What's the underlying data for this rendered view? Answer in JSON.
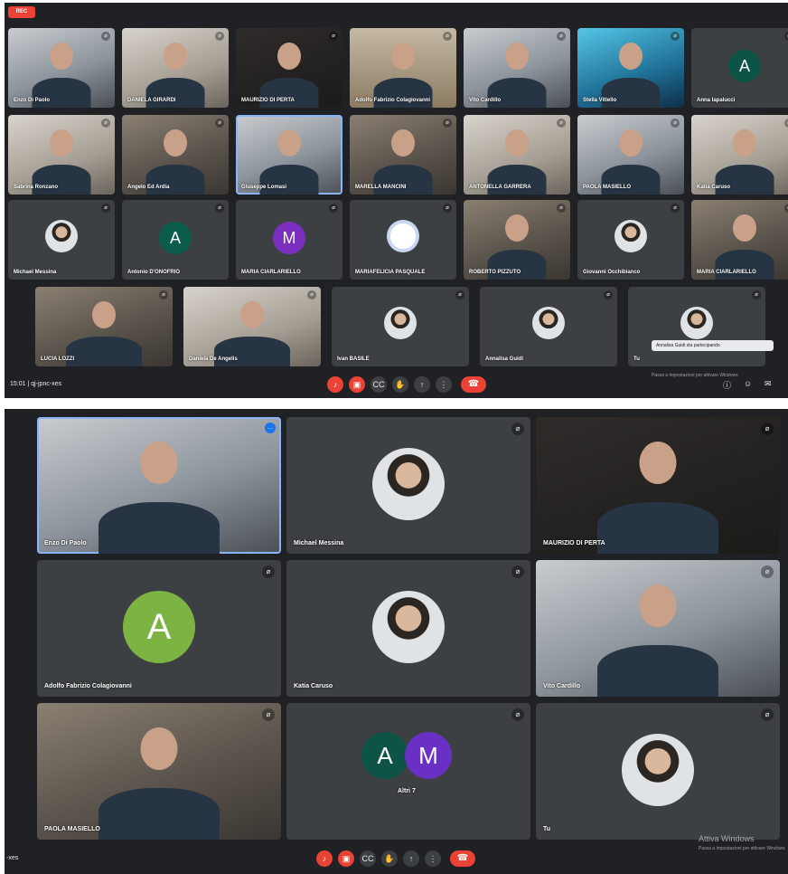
{
  "top": {
    "rec_label": "REC",
    "meeting_time": "15:01",
    "meeting_code": "qj-jpnc-xes",
    "notification_text": "Annalisa Guidi sta partecipando",
    "windows_hint": "Passa a Impostazioni per attivare Windows",
    "rows": [
      [
        "Enzo Di Paolo",
        "DANIELA GIRARDI",
        "MAURIZIO DI PERTA",
        "Adolfo Fabrizio Colagiovanni",
        "Vito Cardillo",
        "Stella Vitiello",
        "Anna Iapaluccì"
      ],
      [
        "Sabrina Ronzano",
        "Angelo Ed Ardia",
        "Giuseppe Lomasi",
        "MARELLA MANCINI",
        "ANTONELLA GARRERA",
        "PAOLA MASIELLO",
        "Katia Caruso"
      ],
      [
        "Michael Messina",
        "Antonio D'ONOFRIO",
        "MARIA CIARLARIELLO",
        "MARIAFELICIA PASQUALE",
        "ROBERTO PIZZUTO",
        "Giovanni Occhibianco",
        "MARIA CIARLARIELLO"
      ],
      [
        "LUCIA LOZZI",
        "Daniela De Angelis",
        "Ivan BASILE",
        "Annalisa Guidi",
        "Tu"
      ]
    ],
    "avatar_letters": {
      "anna": "A",
      "antonio": "A",
      "maria": "M"
    }
  },
  "bottom": {
    "meeting_code_suffix": "-xes",
    "tiles": [
      {
        "name": "Enzo Di Paolo"
      },
      {
        "name": "Michael Messina"
      },
      {
        "name": "MAURIZIO DI PERTA"
      },
      {
        "name": "Adolfo Fabrizio Colagiovanni",
        "letter": "A"
      },
      {
        "name": "Katia Caruso"
      },
      {
        "name": "Vito Cardillo"
      },
      {
        "name": "PAOLA MASIELLO"
      },
      {
        "name": "Altri 7",
        "letters": [
          "A",
          "M"
        ]
      },
      {
        "name": "Tu"
      }
    ],
    "watermark_title": "Attiva Windows",
    "watermark_sub": "Passa a Impostazioni per attivare Windows"
  },
  "toolbar": {
    "mic_icon": "♪",
    "cam_icon": "▣",
    "cc_icon": "CC",
    "hand_icon": "✋",
    "present_icon": "↑",
    "more_icon": "⋮",
    "end_icon": "☎"
  },
  "icons": {
    "mic": "⌀",
    "more": "…",
    "info": "ⓘ",
    "people": "☺",
    "chat": "✉"
  },
  "colors": {
    "meet_bg": "#202124",
    "tile_bg": "#3c4043",
    "red": "#ea4335",
    "avatar_teal": "#0b5c4a",
    "avatar_purple": "#7b2fbe",
    "avatar_green": "#7cb342",
    "avatar_dark_teal": "#0d5346",
    "avatar_violet": "#6a2fc4",
    "active_border": "#8ab4f8"
  }
}
